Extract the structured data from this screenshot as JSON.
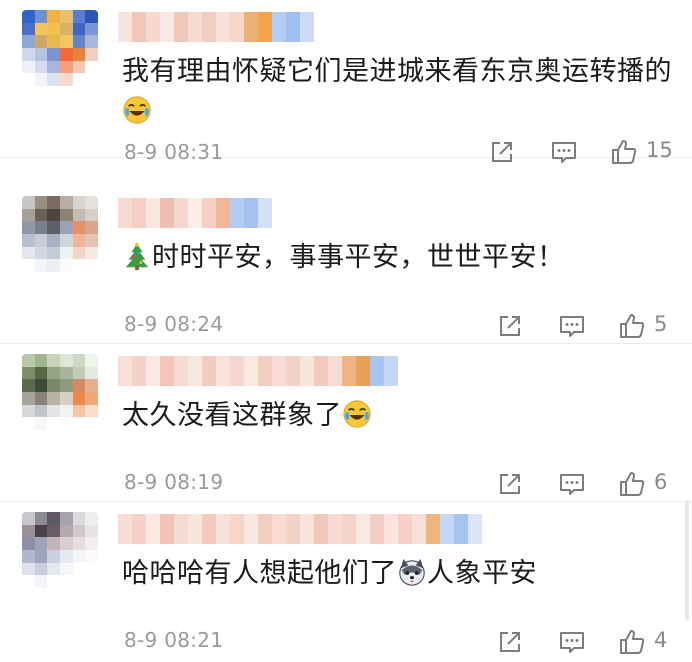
{
  "comments": [
    {
      "text": "我有理由怀疑它们是进城来看东京奥运转播的",
      "trailing_emoji": "crying-laughing-emoji",
      "time": "8-9 08:31",
      "likes": "15",
      "avatar_colors": [
        "#2f63c9",
        "#6f8fd6",
        "#f0b244",
        "#e8c16a",
        "#5b7bcc",
        "#2b56b8",
        "#4a6fc4",
        "#f2c55a",
        "#f3bf4d",
        "#d9b25f",
        "#3d66c2",
        "#7b96d4",
        "#8fa6d8",
        "#c9a86a",
        "#e9b94e",
        "#f2c760",
        "#6583c9",
        "#a7b7dc",
        "#cfd7ea",
        "#b5c3e0",
        "#7d95cf",
        "#f06a3a",
        "#e8823e",
        "#f3cfbd",
        "#eef1f8",
        "#d6dcee",
        "#a9b5da",
        "#f5a07a",
        "#f4c7b2",
        "#ffffff",
        "#ffffff",
        "#f1f3f9",
        "#dce2f0",
        "#f6d9cd",
        "#ffffff",
        "#ffffff"
      ],
      "name_colors": [
        "#f7e4df",
        "#f2c7b9",
        "#f5d8cf",
        "#f9e9e4",
        "#f2c6b8",
        "#f7dbd2",
        "#f3cdc1",
        "#f8e1da",
        "#f6d6cb",
        "#e9b07a",
        "#f3a34a",
        "#b6cdf2",
        "#9fc0f0",
        "#cddcf6"
      ]
    },
    {
      "text": "时时平安，事事平安，世世平安！",
      "leading_emoji": "christmas-tree-emoji",
      "time": "8-9 08:24",
      "likes": "5",
      "avatar_colors": [
        "#c9c7c3",
        "#9b8f84",
        "#7c6c5f",
        "#b7ada3",
        "#d8d4cf",
        "#e4e1dc",
        "#a6a09a",
        "#6b5f54",
        "#4e463e",
        "#8e8277",
        "#c3bcb4",
        "#d9cec4",
        "#8f97a8",
        "#7a808d",
        "#5d6068",
        "#9aa3b6",
        "#e8906a",
        "#d9a68d",
        "#b7c0d2",
        "#c7ccd6",
        "#a8b1c3",
        "#cfd4de",
        "#f0b496",
        "#e6c4b3",
        "#e3e6ec",
        "#d2d7e0",
        "#c4cbd8",
        "#eef0f4",
        "#f3d6c8",
        "#f7e8e0",
        "#ffffff",
        "#f4f5f8",
        "#eceef2",
        "#fbfbfc",
        "#ffffff",
        "#ffffff"
      ],
      "name_colors": [
        "#f7dbd3",
        "#f5cfc4",
        "#f9e7e2",
        "#f1bfb1",
        "#f6d7cd",
        "#fbeeea",
        "#f6d0c4",
        "#f3b59c",
        "#b4cbf2",
        "#a5c2f0",
        "#d3e0f7"
      ]
    },
    {
      "text": "太久没看这群象了",
      "trailing_emoji": "crying-laughing-emoji",
      "time": "8-9 08:19",
      "likes": "6",
      "avatar_colors": [
        "#b7c9a9",
        "#9fb58e",
        "#c8d3bb",
        "#e0e5d8",
        "#cdd8c0",
        "#f0f2ec",
        "#7d8e6b",
        "#58664a",
        "#94a380",
        "#a9b59a",
        "#c3cbb6",
        "#e6e9e0",
        "#5c6b4f",
        "#3f4a36",
        "#7a8869",
        "#8f9c80",
        "#d28b62",
        "#e6b08f",
        "#a8a399",
        "#888279",
        "#b9b2a7",
        "#d6d0c6",
        "#ec8a4c",
        "#f0a878",
        "#d5d7d9",
        "#c1c4c8",
        "#e3e4e6",
        "#f2f2f3",
        "#f6c4a6",
        "#f9dccb",
        "#ffffff",
        "#f7f7f8",
        "#ffffff",
        "#ffffff",
        "#ffffff",
        "#ffffff"
      ],
      "name_colors": [
        "#f8e0d8",
        "#f5d2c7",
        "#fae9e4",
        "#f3c6b8",
        "#f7dbd2",
        "#f9e6e0",
        "#f4cbbf",
        "#f8e2db",
        "#f6d6cc",
        "#fae8e2",
        "#f4cdc1",
        "#f7ddd5",
        "#f5d2c7",
        "#f9e5de",
        "#f3c9bc",
        "#f7dcd3",
        "#f0b485",
        "#e9a058",
        "#a9c5f1",
        "#c4d7f5"
      ]
    },
    {
      "text": "哈哈哈有人想起他们了",
      "after_emoji": "husky-dog-emoji",
      "text2": "人象平安",
      "time": "8-9 08:21",
      "likes": "4",
      "avatar_colors": [
        "#c8c6cc",
        "#8e8a93",
        "#5f5963",
        "#a7a3ac",
        "#dcdadf",
        "#eeedf0",
        "#9d8f98",
        "#4d4149",
        "#6a5c65",
        "#b5a9b0",
        "#cfc8cc",
        "#e7e3e5",
        "#8c8fa6",
        "#a0a3b8",
        "#c3b4b9",
        "#d9cdd0",
        "#e6dde0",
        "#f2eef0",
        "#b2b7cc",
        "#9fa5c0",
        "#cdd1df",
        "#e8eaf1",
        "#f4f5f8",
        "#fafafc",
        "#dfe2ec",
        "#c8cde0",
        "#e6e8ef",
        "#f6f7fa",
        "#ffffff",
        "#ffffff",
        "#ffffff",
        "#f4f5f9",
        "#ffffff",
        "#ffffff",
        "#ffffff",
        "#ffffff"
      ],
      "name_colors": [
        "#f8ded6",
        "#f5d1c6",
        "#fae8e3",
        "#f2c4b6",
        "#f7dad1",
        "#f9e4de",
        "#f4cabe",
        "#f8e1da",
        "#f6d5cb",
        "#fae7e1",
        "#f4ccc0",
        "#f7dcd4",
        "#f5d1c6",
        "#f9e4dd",
        "#f3c8bb",
        "#f7dbd2",
        "#f6d3c9",
        "#fae9e3",
        "#f4cec2",
        "#f9e3dc",
        "#f5d0c5",
        "#f8e0d8",
        "#f0b57f",
        "#c6d8f5",
        "#a7c3f1",
        "#dbe6f8"
      ]
    }
  ]
}
